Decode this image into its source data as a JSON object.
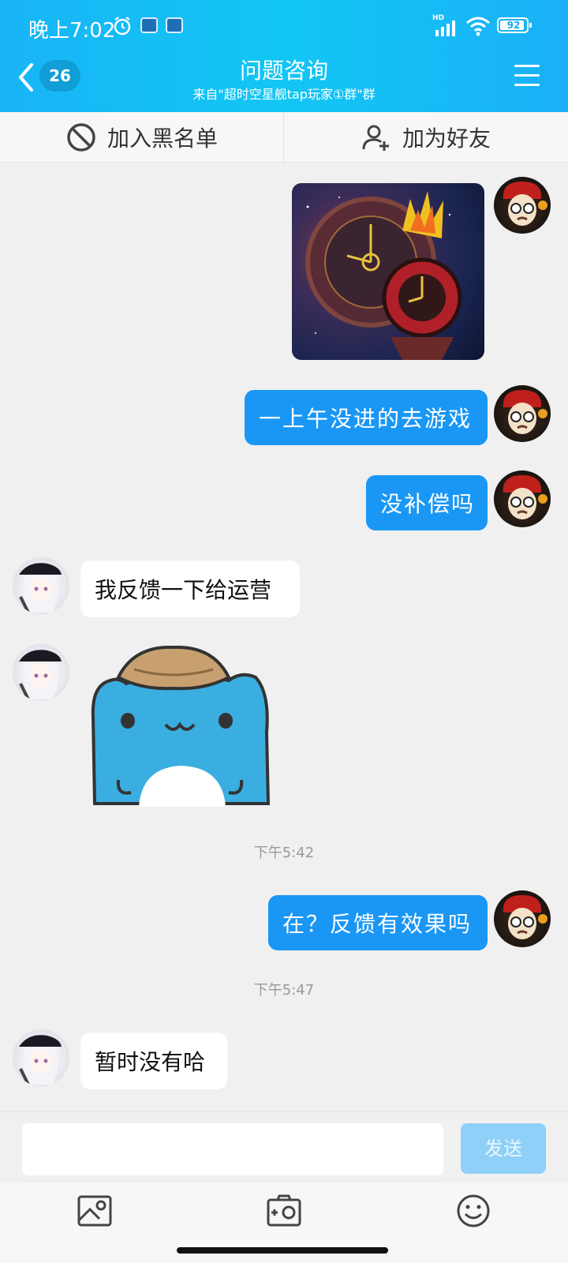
{
  "status_bar": {
    "time": "晚上7:02",
    "network": "HD",
    "battery": "92"
  },
  "header": {
    "back_count": "26",
    "title": "问题咨询",
    "subtitle": "来自\"超时空星舰tap玩家①群\"群"
  },
  "actions": {
    "block_label": "加入黑名单",
    "add_friend_label": "加为好友"
  },
  "messages": [
    {
      "from": "me",
      "type": "image"
    },
    {
      "from": "me",
      "type": "text",
      "text": "一上午没进的去游戏"
    },
    {
      "from": "me",
      "type": "text",
      "text": "没补偿吗"
    },
    {
      "from": "other",
      "type": "text",
      "text": "我反馈一下给运营"
    },
    {
      "from": "other",
      "type": "sticker"
    },
    {
      "type": "timestamp",
      "text": "下午5:42"
    },
    {
      "from": "me",
      "type": "text",
      "text": "在？反馈有效果吗"
    },
    {
      "type": "timestamp",
      "text": "下午5:47"
    },
    {
      "from": "other",
      "type": "text",
      "text": "暂时没有哈"
    }
  ],
  "composer": {
    "input_value": "",
    "send_label": "发送"
  },
  "toolbar": {
    "icons": [
      "image-icon",
      "camera-icon",
      "emoji-icon"
    ]
  },
  "colors": {
    "header": "#18b4f6",
    "my_bubble": "#1a97f5",
    "send_disabled": "#8fd0f8"
  }
}
